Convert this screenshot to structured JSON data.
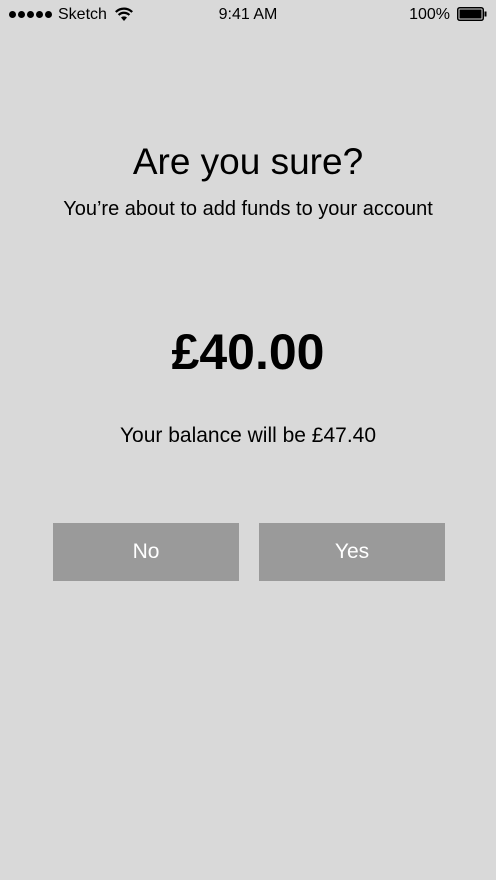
{
  "status_bar": {
    "carrier": "Sketch",
    "time": "9:41 AM",
    "battery_percent": "100%",
    "signal_bars": 5,
    "battery_level": 1.0,
    "icons": [
      "signal-dots-icon",
      "wifi-icon",
      "battery-icon"
    ]
  },
  "dialog": {
    "title": "Are you sure?",
    "subtitle": "You’re about to add funds to your account",
    "amount": "£40.00",
    "balance_text": "Your balance will be £47.40"
  },
  "actions": {
    "no_label": "No",
    "yes_label": "Yes"
  },
  "colors": {
    "background": "#d9d9d9",
    "button": "#9a9a9a",
    "button_text": "#ffffff",
    "text": "#000000"
  }
}
